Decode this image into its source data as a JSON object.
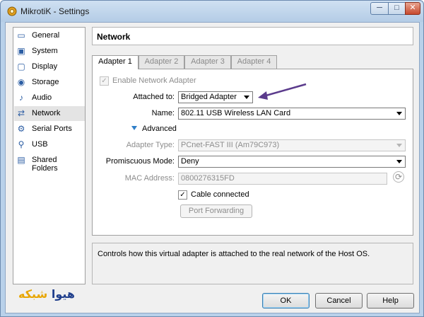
{
  "window": {
    "title": "MikrotiK - Settings",
    "icon": "gear-icon",
    "controls": {
      "minimize": "─",
      "maximize": "□",
      "close": "✕"
    }
  },
  "sidebar": {
    "items": [
      {
        "label": "General",
        "icon": "monitor-icon",
        "glyph": "▭"
      },
      {
        "label": "System",
        "icon": "chip-icon",
        "glyph": "▣"
      },
      {
        "label": "Display",
        "icon": "display-icon",
        "glyph": "▢"
      },
      {
        "label": "Storage",
        "icon": "disk-icon",
        "glyph": "◉"
      },
      {
        "label": "Audio",
        "icon": "speaker-icon",
        "glyph": "♪"
      },
      {
        "label": "Network",
        "icon": "network-icon",
        "glyph": "⇄",
        "selected": true
      },
      {
        "label": "Serial Ports",
        "icon": "serial-port-icon",
        "glyph": "⚙"
      },
      {
        "label": "USB",
        "icon": "usb-icon",
        "glyph": "⚲"
      },
      {
        "label": "Shared Folders",
        "icon": "folder-icon",
        "glyph": "▤"
      }
    ]
  },
  "header": {
    "title": "Network"
  },
  "tabs": [
    {
      "label": "Adapter 1",
      "active": true
    },
    {
      "label": "Adapter 2"
    },
    {
      "label": "Adapter 3"
    },
    {
      "label": "Adapter 4"
    }
  ],
  "adapter": {
    "enable_label": "Enable Network Adapter",
    "enable_checked": "✓",
    "attached_label": "Attached to:",
    "attached_value": "Bridged Adapter",
    "name_label": "Name:",
    "name_value": "802.11 USB Wireless LAN Card",
    "advanced_label": "Advanced",
    "adapter_type_label": "Adapter Type:",
    "adapter_type_value": "PCnet-FAST III (Am79C973)",
    "promiscuous_label": "Promiscuous Mode:",
    "promiscuous_value": "Deny",
    "mac_label": "MAC Address:",
    "mac_value": "0800276315FD",
    "refresh_glyph": "⟳",
    "cable_label": "Cable connected",
    "cable_checked": "✓",
    "port_forwarding_label": "Port Forwarding"
  },
  "description": "Controls how this virtual adapter is attached to the real network of the Host OS.",
  "buttons": {
    "ok": "OK",
    "cancel": "Cancel",
    "help": "Help"
  },
  "watermark": {
    "part1": "هیوا",
    "part2": "شبکه"
  },
  "colors": {
    "arrow": "#5b3b8c",
    "titlebar": "#b9d1ea"
  }
}
